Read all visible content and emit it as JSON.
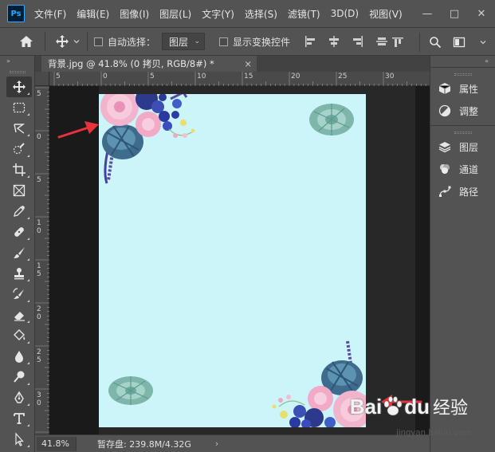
{
  "app": {
    "logo_text": "Ps"
  },
  "menu": [
    "文件(F)",
    "编辑(E)",
    "图像(I)",
    "图层(L)",
    "文字(Y)",
    "选择(S)",
    "滤镜(T)",
    "3D(D)",
    "视图(V)"
  ],
  "window_controls": {
    "minimize": "—",
    "restore": "□",
    "close": "✕"
  },
  "options_bar": {
    "auto_select_label": "自动选择：",
    "auto_select_target": "图层",
    "show_transform_label": "显示变换控件"
  },
  "document": {
    "tab_title": "背景.jpg @ 41.8% (0 拷贝, RGB/8#) *",
    "close_glyph": "×",
    "ruler_h_labels": [
      "5",
      "0",
      "5",
      "10",
      "15",
      "20",
      "25",
      "30"
    ],
    "ruler_v_labels": [
      "5",
      "0",
      "5",
      "1\n0",
      "1\n5",
      "2\n0",
      "2\n5",
      "3\n0",
      "3\n5"
    ],
    "artboard_color": "#ccf5fa"
  },
  "status": {
    "zoom": "41.8%",
    "scratch_disk": "暂存盘: 239.8M/4.32G",
    "arrow": "›"
  },
  "right_panel": {
    "groups": [
      [
        {
          "label": "属性",
          "icon": "properties-icon"
        },
        {
          "label": "调整",
          "icon": "adjustments-icon"
        }
      ],
      [
        {
          "label": "图层",
          "icon": "layers-icon"
        },
        {
          "label": "通道",
          "icon": "channels-icon"
        },
        {
          "label": "路径",
          "icon": "paths-icon"
        }
      ]
    ]
  },
  "watermark": {
    "brand_a": "Bai",
    "brand_b": "du",
    "brand_cn": "经验",
    "url": "jingyan.baidu.com"
  },
  "colors": {
    "annotation_arrow": "#e8323c",
    "accent": "#31a8ff"
  }
}
